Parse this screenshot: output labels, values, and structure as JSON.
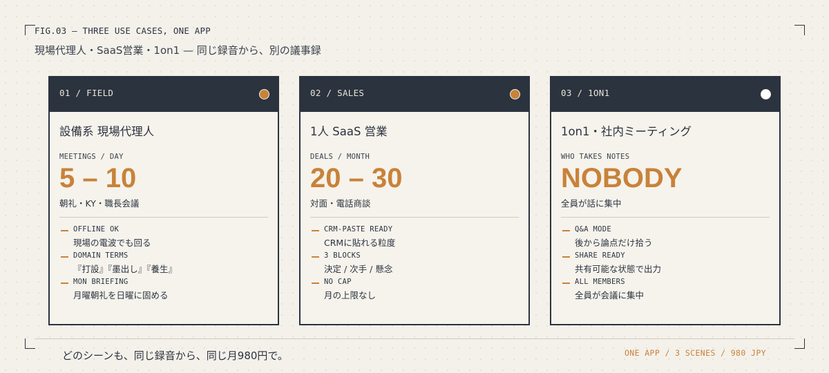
{
  "header": {
    "fig_label": "FIG.03 — THREE USE CASES, ONE APP",
    "title": "現場代理人・SaaS営業・1on1 — 同じ録音から、別の議事録"
  },
  "colors": {
    "accent": "#c8823a",
    "dark": "#2b333f",
    "background": "#f4f1ea",
    "white_dot": "#ffffff"
  },
  "cards": [
    {
      "tag": "01 / FIELD",
      "dot_color": "#c8823a",
      "title": "設備系 現場代理人",
      "metric_label": "MEETINGS / DAY",
      "metric_value": "5 – 10",
      "metric_sub": "朝礼・KY・職長会議",
      "points": [
        {
          "key": "OFFLINE OK",
          "value": "現場の電波でも回る"
        },
        {
          "key": "DOMAIN TERMS",
          "value": "『打設』『墨出し』『養生』"
        },
        {
          "key": "MON BRIEFING",
          "value": "月曜朝礼を日曜に固める"
        }
      ]
    },
    {
      "tag": "02 / SALES",
      "dot_color": "#c8823a",
      "title": "1人 SaaS 営業",
      "metric_label": "DEALS / MONTH",
      "metric_value": "20 – 30",
      "metric_sub": "対面・電話商談",
      "points": [
        {
          "key": "CRM-PASTE READY",
          "value": "CRMに貼れる粒度"
        },
        {
          "key": "3 BLOCKS",
          "value": "決定 / 次手 / 懸念"
        },
        {
          "key": "NO CAP",
          "value": "月の上限なし"
        }
      ]
    },
    {
      "tag": "03 / 1ON1",
      "dot_color": "#ffffff",
      "title": "1on1・社内ミーティング",
      "metric_label": "WHO TAKES NOTES",
      "metric_value": "NOBODY",
      "metric_sub": "全員が話に集中",
      "points": [
        {
          "key": "Q&A MODE",
          "value": "後から論点だけ拾う"
        },
        {
          "key": "SHARE READY",
          "value": "共有可能な状態で出力"
        },
        {
          "key": "ALL MEMBERS",
          "value": "全員が会議に集中"
        }
      ]
    }
  ],
  "footer": {
    "tagline": "どのシーンも、同じ録音から、同じ月980円で。",
    "summary": "ONE APP / 3 SCENES / 980 JPY"
  }
}
